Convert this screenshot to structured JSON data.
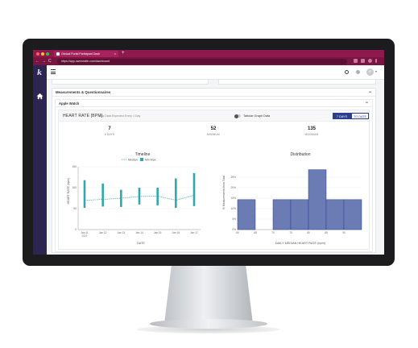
{
  "browser": {
    "tab_title": "Clinical Portal Participant Dash",
    "tab_close": "×",
    "new_tab": "+",
    "url": "https://app.ownhealth.com/dashboard",
    "back": "←",
    "forward": "→",
    "reload": "C"
  },
  "app": {
    "logo_letter": "k",
    "avatar_initials": "AP",
    "caret": "▾"
  },
  "panel": {
    "title": "Measurements & Questionnaires",
    "collapse": "−"
  },
  "subpanel": {
    "title": "Apple Watch",
    "collapse": "−"
  },
  "card": {
    "metric_title": "HEART RATE [BPM]",
    "metric_subtitle": "New Data Expected Every 1 Day",
    "toggle_label": "Tabular Graph Data",
    "range_active": "7 DAYS",
    "range_other": "TO DATE"
  },
  "stats": [
    {
      "value": "7",
      "label": "# DAYS"
    },
    {
      "value": "52",
      "label": "MINIMUM"
    },
    {
      "value": "135",
      "label": "MAXIMUM"
    }
  ],
  "colors": {
    "timeline_bar": "#2fa7b0",
    "timeline_median": "#2fa7b0",
    "histogram_fill": "#6b7bb3",
    "histogram_stroke": "#2c3e8f",
    "sidebar": "#2c2451",
    "browser": "#8e1a4d"
  },
  "chart_data": [
    {
      "type": "line",
      "title": "Timeline",
      "legend": [
        "Median",
        "Min Max"
      ],
      "legend_placement": "top",
      "xlabel": "DATE",
      "ylabel": "HEART RATE (bpm)",
      "categories": [
        "Jan 11",
        "Jan 12",
        "Jan 13",
        "Jan 14",
        "Jan 15",
        "Jan 16",
        "Jan 17"
      ],
      "x_sublabel": "2021",
      "ylim": [
        0,
        150
      ],
      "yticks": [
        "0",
        "50",
        "100",
        "150"
      ],
      "series": [
        {
          "name": "Median",
          "values": [
            70,
            72,
            75,
            79,
            80,
            70,
            82
          ]
        },
        {
          "name": "Min Max",
          "min": [
            52,
            55,
            54,
            60,
            58,
            52,
            56
          ],
          "max": [
            118,
            110,
            95,
            100,
            100,
            122,
            135
          ]
        }
      ]
    },
    {
      "type": "bar",
      "title": "Distribution",
      "xlabel": "DAILY MEDIAN HEART RATE (bpm)",
      "ylabel": "% Measurements from Total",
      "bin_edges": [
        60,
        65,
        70,
        75,
        80,
        85,
        90,
        95
      ],
      "xticks": [
        "60",
        "65",
        "70",
        "75",
        "80",
        "85",
        "90"
      ],
      "yticks": [
        "0%",
        "5%",
        "10%",
        "15%",
        "20%",
        "25%"
      ],
      "ylim": [
        0,
        30
      ],
      "values": [
        14.3,
        0,
        14.3,
        14.3,
        28.6,
        14.3,
        14.3
      ]
    }
  ]
}
